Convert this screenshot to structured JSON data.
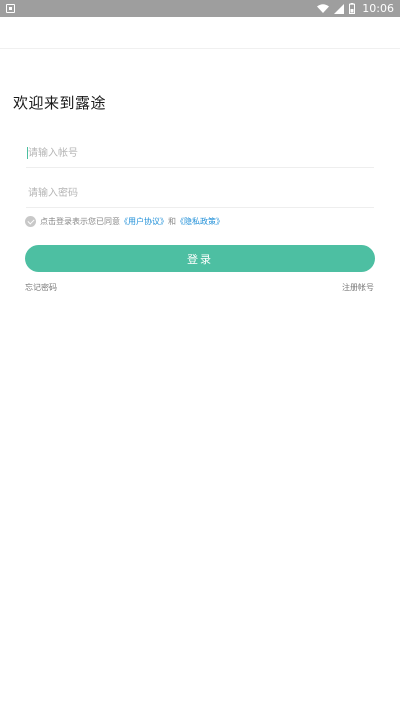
{
  "status_bar": {
    "time": "10:06",
    "icons": [
      "app-notification-icon",
      "wifi-icon",
      "signal-icon",
      "battery-icon"
    ]
  },
  "login": {
    "title": "欢迎来到露途",
    "account_placeholder": "请输入帐号",
    "password_placeholder": "请输入密码",
    "agreement_prefix": "点击登录表示您已同意",
    "user_agreement": "《用户协议》",
    "agreement_and": "和",
    "privacy_policy": "《隐私政策》",
    "login_button": "登录",
    "forgot_password": "忘记密码",
    "register_account": "注册帐号"
  },
  "colors": {
    "accent": "#4dbfa2",
    "link": "#1f8fd8",
    "status_bar": "#9e9e9e"
  }
}
